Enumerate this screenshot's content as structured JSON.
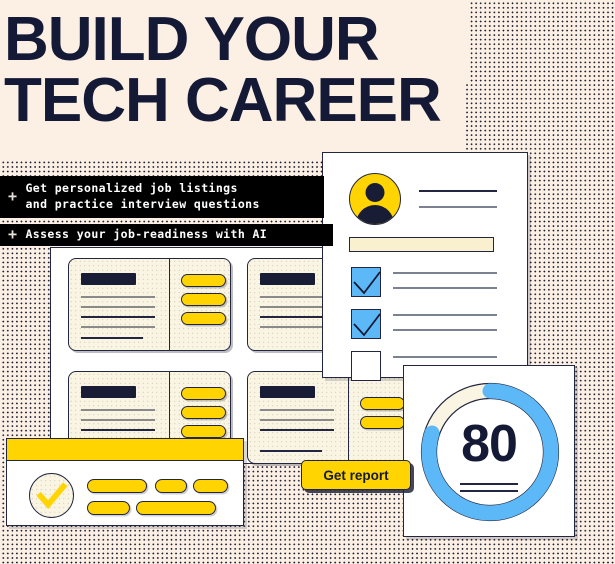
{
  "theme": {
    "background": "#FCEFE4",
    "ink": "#141A36",
    "accent_yellow": "#FFD400",
    "accent_blue": "#5CB8F7",
    "card_cream": "#FAF4E2"
  },
  "headline": {
    "line1": "BUILD YOUR",
    "line2": "TECH CAREER"
  },
  "bullets": [
    {
      "marker": "+",
      "line1": "Get personalized job listings",
      "line2": "and practice interview questions"
    },
    {
      "marker": "+",
      "line1": "Assess your job-readiness with AI",
      "line2": ""
    }
  ],
  "cards_panel": {
    "cards": [
      {
        "name": "job-card-1"
      },
      {
        "name": "job-card-2"
      },
      {
        "name": "job-card-3"
      },
      {
        "name": "job-card-4"
      }
    ]
  },
  "checklist_panel": {
    "avatar": "user-avatar",
    "items": [
      {
        "state": "checked"
      },
      {
        "state": "checked"
      },
      {
        "state": "unchecked"
      }
    ]
  },
  "score_card": {
    "value": "80",
    "gauge_percent": 80,
    "gauge_track_color": "#FAF4E2",
    "gauge_fill_color": "#5CB8F7"
  },
  "get_report_button": {
    "label": "Get report"
  },
  "check_card": {
    "icon": "check-circle-icon"
  }
}
